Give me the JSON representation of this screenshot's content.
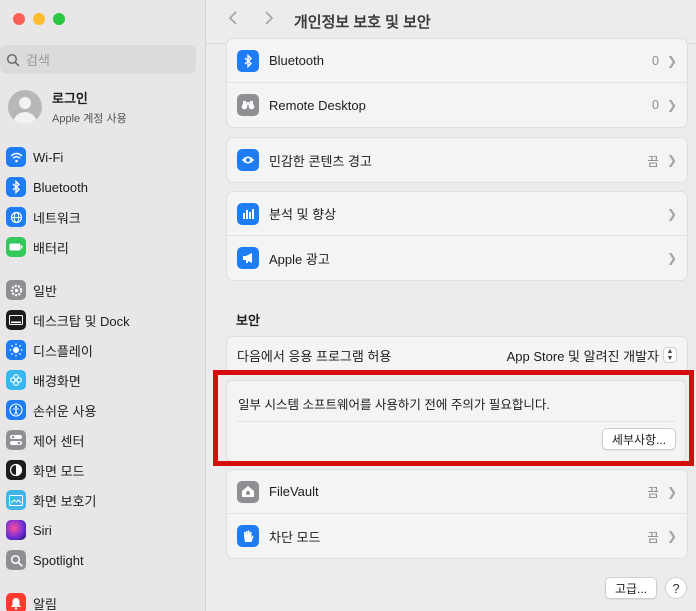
{
  "colors": {
    "close": "#ff5f57",
    "minimize": "#febc2e",
    "maximize": "#28c840",
    "accent": "#1e7cf5",
    "highlight": "#d60b0b"
  },
  "search": {
    "placeholder": "검색"
  },
  "profile": {
    "name": "로그인",
    "subtitle": "Apple 계정 사용"
  },
  "sidebar": {
    "group1": [
      {
        "label": "Wi-Fi",
        "icon": "wifi-icon",
        "color": "#1e7cf5"
      },
      {
        "label": "Bluetooth",
        "icon": "bluetooth-icon",
        "color": "#1e7cf5"
      },
      {
        "label": "네트워크",
        "icon": "globe-icon",
        "color": "#1e7cf5"
      },
      {
        "label": "배터리",
        "icon": "battery-icon",
        "color": "#34c759"
      }
    ],
    "group2": [
      {
        "label": "일반",
        "icon": "gear-icon",
        "color": "#8e8e93"
      },
      {
        "label": "데스크탑 및 Dock",
        "icon": "dock-icon",
        "color": "#1c1c1e"
      },
      {
        "label": "디스플레이",
        "icon": "sun-icon",
        "color": "#1e7cf5"
      },
      {
        "label": "배경화면",
        "icon": "flower-icon",
        "color": "#35b8f0"
      },
      {
        "label": "손쉬운 사용",
        "icon": "accessibility-icon",
        "color": "#1e7cf5"
      },
      {
        "label": "제어 센터",
        "icon": "control-center-icon",
        "color": "#8e8e93"
      },
      {
        "label": "화면 모드",
        "icon": "appearance-icon",
        "color": "#1c1c1e"
      },
      {
        "label": "화면 보호기",
        "icon": "screensaver-icon",
        "color": "#3fb6e8"
      },
      {
        "label": "Siri",
        "icon": "siri-icon",
        "color": "#a03ad8"
      },
      {
        "label": "Spotlight",
        "icon": "magnifier-icon",
        "color": "#8e8e93"
      }
    ],
    "group3": [
      {
        "label": "알림",
        "icon": "bell-icon",
        "color": "#ff3b30"
      }
    ]
  },
  "window": {
    "title": "개인정보 보호 및 보안"
  },
  "privacy": {
    "group1": [
      {
        "label": "Bluetooth",
        "value": "0",
        "icon": "bluetooth-icon",
        "color": "#1e7cf5"
      },
      {
        "label": "Remote Desktop",
        "value": "0",
        "icon": "binoculars-icon",
        "color": "#8e8e93"
      }
    ],
    "group2": [
      {
        "label": "민감한 콘텐츠 경고",
        "value": "끔",
        "icon": "eye-icon",
        "color": "#1e7cf5"
      }
    ],
    "group3": [
      {
        "label": "분석 및 향상",
        "value": "",
        "icon": "chart-icon",
        "color": "#1e7cf5"
      },
      {
        "label": "Apple 광고",
        "value": "",
        "icon": "megaphone-icon",
        "color": "#1e7cf5"
      }
    ]
  },
  "security": {
    "section_title": "보안",
    "allow_label": "다음에서 응용 프로그램 허용",
    "allow_value": "App Store 및 알려진 개발자",
    "warning_text": "일부 시스템 소프트웨어를 사용하기 전에 주의가 필요합니다.",
    "details_button": "세부사항...",
    "filevault": {
      "label": "FileVault",
      "value": "끔"
    },
    "lockdown": {
      "label": "차단 모드",
      "value": "끔"
    }
  },
  "footer": {
    "advanced_button": "고급...",
    "help_button": "?"
  }
}
